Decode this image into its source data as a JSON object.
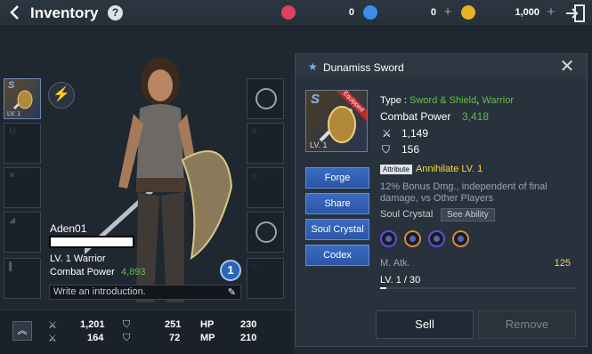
{
  "header": {
    "title": "Inventory",
    "help": "?",
    "currencies": [
      {
        "icon": "red-gem-icon",
        "value": "0"
      },
      {
        "icon": "blue-diamond-icon",
        "value": "0"
      },
      {
        "icon": "gold-coin-icon",
        "value": "1,000"
      }
    ]
  },
  "character": {
    "name": "Aden01",
    "level": "LV. 1  Warrior",
    "combat_power_label": "Combat Power",
    "combat_power": "4,893",
    "badge": "1",
    "intro_placeholder": "Write an introduction."
  },
  "stats": {
    "atk1": "1,201",
    "atk2": "251",
    "hp_label": "HP",
    "hp": "230",
    "def1": "164",
    "def2": "72",
    "mp_label": "MP",
    "mp": "210"
  },
  "weapon_slot": {
    "grade": "S",
    "level": "LV. 1"
  },
  "panel": {
    "title": "Dunamiss Sword",
    "grade": "S",
    "level": "LV. 1",
    "equipped": "Equipped",
    "type_label": "Type :",
    "type_value": "Sword & Shield",
    "type_sep": ",",
    "type_class": "Warrior",
    "combat_power_label": "Combat Power",
    "combat_power": "3,418",
    "stat_attack": "1,149",
    "stat_defense": "156",
    "buttons": [
      "Forge",
      "Share",
      "Soul Crystal",
      "Codex"
    ],
    "attribute_label": "Attribute",
    "attribute_name": "Annihilate LV. 1",
    "attribute_desc": "12% Bonus Dmg., independent of final damage, vs Other Players",
    "soul_crystal_label": "Soul Crystal",
    "see_ability": "See Ability",
    "matk_label": "M. Atk.",
    "matk_value": "125",
    "item_level": "LV. 1 / 30",
    "level_progress": 0.033,
    "sell": "Sell",
    "remove": "Remove"
  }
}
